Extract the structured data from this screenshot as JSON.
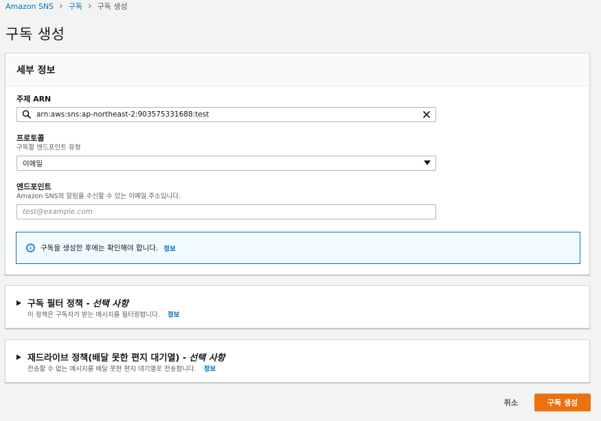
{
  "breadcrumb": {
    "items": [
      {
        "label": "Amazon SNS"
      },
      {
        "label": "구독"
      },
      {
        "label": "구독 생성"
      }
    ]
  },
  "page": {
    "title": "구독 생성"
  },
  "details": {
    "header": "세부 정보",
    "topic_arn": {
      "label": "주제 ARN",
      "value": "arn:aws:sns:ap-northeast-2:903575331688:test"
    },
    "protocol": {
      "label": "프로토콜",
      "description": "구독할 엔드포인트 유형",
      "selected": "이메일"
    },
    "endpoint": {
      "label": "엔드포인트",
      "description": "Amazon SNS의 알림을 수신할 수 있는 이메일 주소입니다.",
      "placeholder": "test@example.com"
    },
    "alert": {
      "text": "구독을 생성한 후에는 확인해야 합니다.",
      "link": "정보"
    }
  },
  "filter_policy": {
    "title": "구독 필터 정책 -",
    "optional": "선택 사항",
    "description": "이 정책은 구독자가 받는 메시지를 필터링합니다.",
    "link": "정보"
  },
  "redrive_policy": {
    "title": "재드라이브 정책(배달 못한 편지 대기열) -",
    "optional": "선택 사항",
    "description": "전송할 수 없는 메시지를 배달 못한 편지 대기열로 전송합니다.",
    "link": "정보"
  },
  "footer": {
    "cancel": "취소",
    "create": "구독 생성"
  },
  "colors": {
    "primary": "#ec7211",
    "link": "#0073bb",
    "background": "#f2f3f3"
  }
}
